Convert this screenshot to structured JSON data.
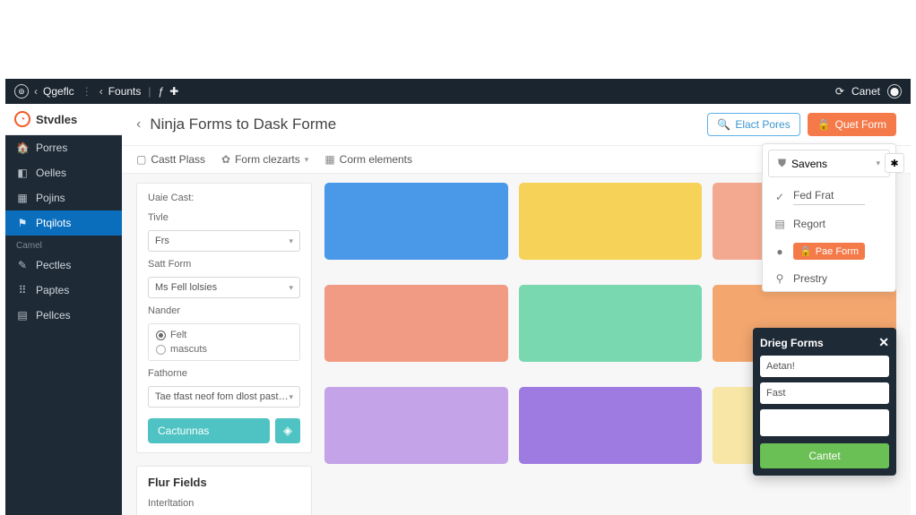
{
  "topbar": {
    "brand_glyph": "⊕",
    "brand_text": "Qgeflc",
    "section": "Founts",
    "user_label": "Canet"
  },
  "sidebar": {
    "logo_text": "Stvdles",
    "items": [
      {
        "icon": "🏠",
        "label": "Porres"
      },
      {
        "icon": "◧",
        "label": "Oelles"
      },
      {
        "icon": "▦",
        "label": "Pojins"
      },
      {
        "icon": "⚑",
        "label": "Ptqilots"
      }
    ],
    "group_label": "Camel",
    "items2": [
      {
        "icon": "✎",
        "label": "Pectles"
      },
      {
        "icon": "⠿",
        "label": "Paptes"
      },
      {
        "icon": "▤",
        "label": "Pellces"
      }
    ]
  },
  "header": {
    "title": "Ninja Forms to Dask Forme",
    "btn_elect": "Elact Pores",
    "btn_quet": "Quet Form"
  },
  "tabs": {
    "t1": "Castt Plass",
    "t2": "Form clezarts",
    "t3": "Corm elements"
  },
  "leftpanel": {
    "group_title": "Uaie Cast:",
    "label_title": "Tivle",
    "value_title": "Frs",
    "label_satform": "Satt Form",
    "value_satform": "Ms Fell lolsies",
    "label_nander": "Nander",
    "radio1": "Felt",
    "radio2": "mascuts",
    "label_fathorne": "Fathorne",
    "value_fathorne": "Tae tfast neof fom dlost pastarts",
    "btn_cactunnes": "Cactunnas"
  },
  "lowerpanel": {
    "title": "Flur Fields",
    "label_interitation": "Interltation"
  },
  "dropdown": {
    "head_label": "Savens",
    "item_fedfrat": "Fed Frat",
    "item_regert": "Regort",
    "item_pae": "Pae Form",
    "item_prestry": "Prestry"
  },
  "dragpanel": {
    "title": "Drieg Forms",
    "input1": "Aetan!",
    "input2": "Fast",
    "btn": "Cantet"
  }
}
